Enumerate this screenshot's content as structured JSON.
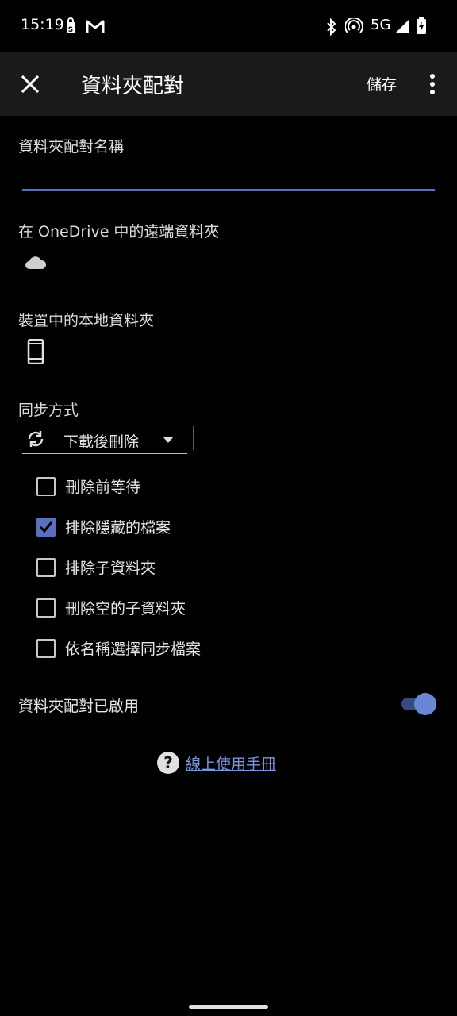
{
  "status_bar": {
    "time": "15:19",
    "network": "5G",
    "icons": [
      "shopping-bag-icon",
      "gmail-icon",
      "bluetooth-icon",
      "hotspot-icon",
      "signal-icon",
      "battery-icon"
    ]
  },
  "app_bar": {
    "close_icon": "close-icon",
    "title": "資料夾配對",
    "save_label": "儲存",
    "more_icon": "more-vert-icon"
  },
  "form": {
    "pair_name": {
      "label": "資料夾配對名稱",
      "value": ""
    },
    "remote_folder": {
      "label": "在 OneDrive 中的遠端資料夾",
      "value": "",
      "icon": "cloud-icon"
    },
    "local_folder": {
      "label": "裝置中的本地資料夾",
      "value": "",
      "icon": "phone-icon"
    },
    "sync_method": {
      "label": "同步方式",
      "selected": "下載後刪除",
      "icon": "sync-icon"
    },
    "options": [
      {
        "label": "刪除前等待",
        "checked": false
      },
      {
        "label": "排除隱藏的檔案",
        "checked": true
      },
      {
        "label": "排除子資料夾",
        "checked": false
      },
      {
        "label": "刪除空的子資料夾",
        "checked": false
      },
      {
        "label": "依名稱選擇同步檔案",
        "checked": false
      }
    ],
    "enabled": {
      "label": "資料夾配對已啟用",
      "on": true
    }
  },
  "help": {
    "link_text": "線上使用手冊",
    "icon": "help-icon"
  },
  "colors": {
    "accent": "#5b6fbf",
    "background": "#000000",
    "app_bar": "#1a1a1a",
    "link": "#7d95e0"
  }
}
